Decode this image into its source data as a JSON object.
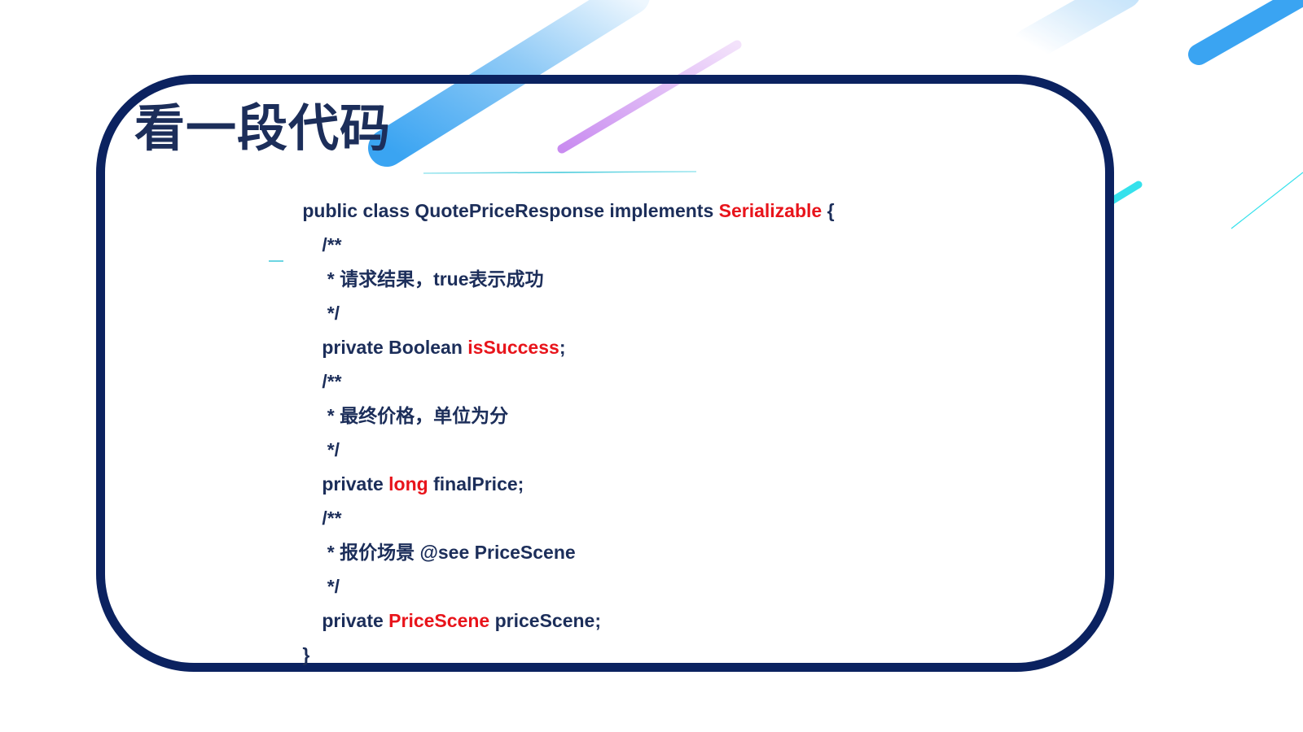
{
  "title": "看一段代码",
  "colors": {
    "frame": "#0b2260",
    "text": "#1c2e5a",
    "highlight": "#e8141b",
    "deco_blue": "#3aa4f2",
    "deco_purple": "#d59cf0",
    "deco_cyan": "#35e1ec"
  },
  "code": {
    "class_decl": {
      "prefix": "public class QuotePriceResponse implements ",
      "highlight": "Serializable",
      "suffix": " {"
    },
    "comment1": {
      "open": "/**",
      "body": " * 请求结果，true表示成功",
      "close": " */"
    },
    "field1": {
      "prefix": "private Boolean ",
      "highlight": "isSuccess",
      "suffix": ";"
    },
    "comment2": {
      "open": "/**",
      "body": " * 最终价格，单位为分",
      "close": " */"
    },
    "field2": {
      "prefix": "private ",
      "highlight": "long",
      "suffix": " finalPrice;"
    },
    "comment3": {
      "open": "/**",
      "body": " * 报价场景 @see PriceScene",
      "close": " */"
    },
    "field3": {
      "prefix": "private ",
      "highlight": "PriceScene",
      "suffix": " priceScene;"
    },
    "closing_brace": "}"
  }
}
